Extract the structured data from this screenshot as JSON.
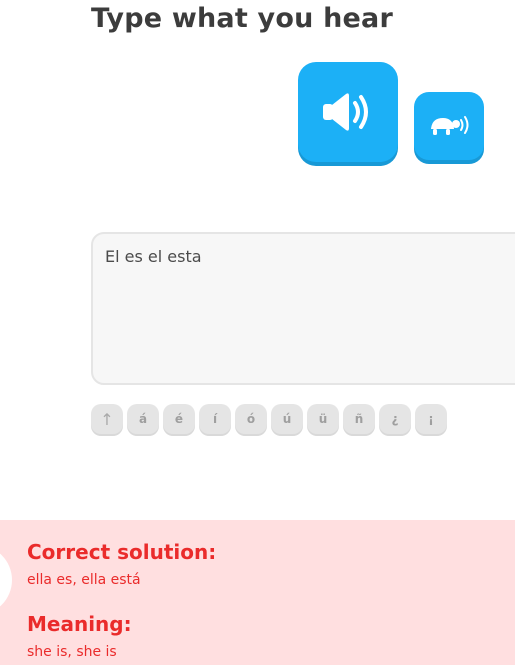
{
  "prompt": {
    "title": "Type what you hear"
  },
  "audio": {
    "play_icon": "speaker-icon",
    "slow_icon": "turtle-icon"
  },
  "answer": {
    "value": "El es el esta"
  },
  "keyboard": {
    "shift_icon": "arrow-up-icon",
    "keys": [
      "↑",
      "á",
      "é",
      "í",
      "ó",
      "ú",
      "ü",
      "ñ",
      "¿",
      "¡"
    ]
  },
  "feedback": {
    "correct_heading": "Correct solution:",
    "correct_text": "ella es, ella está",
    "meaning_heading": "Meaning:",
    "meaning_text": "she is, she is"
  },
  "colors": {
    "accent": "#1cb0f6",
    "accent_shadow": "#1899d6",
    "error": "#ea2b2b",
    "error_bg": "#ffdfe0"
  }
}
